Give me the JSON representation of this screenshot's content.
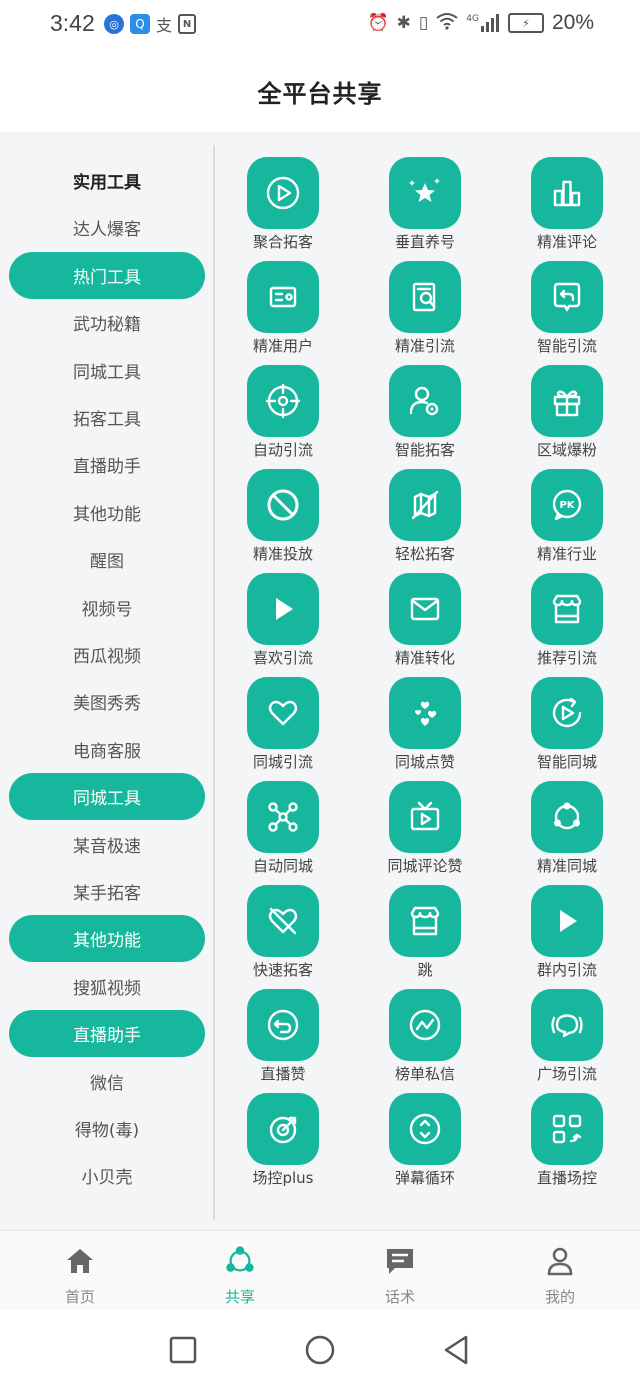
{
  "status_bar": {
    "time": "3:42",
    "left_icons": [
      "app-icon-1",
      "search-app-icon",
      "alipay-icon",
      "nfc-icon"
    ],
    "right_icons": [
      "alarm-icon",
      "bluetooth-icon",
      "vibrate-icon",
      "wifi-icon",
      "signal-icon",
      "battery-icon"
    ],
    "network": "4G",
    "battery": "20%"
  },
  "header": {
    "title": "全平台共享"
  },
  "sidebar": {
    "items": [
      {
        "label": "实用工具",
        "style": "bold"
      },
      {
        "label": "达人爆客",
        "style": "normal"
      },
      {
        "label": "热门工具",
        "style": "active"
      },
      {
        "label": "武功秘籍",
        "style": "normal"
      },
      {
        "label": "同城工具",
        "style": "normal"
      },
      {
        "label": "拓客工具",
        "style": "normal"
      },
      {
        "label": "直播助手",
        "style": "normal"
      },
      {
        "label": "其他功能",
        "style": "normal"
      },
      {
        "label": "醒图",
        "style": "normal"
      },
      {
        "label": "视频号",
        "style": "normal"
      },
      {
        "label": "西瓜视频",
        "style": "normal"
      },
      {
        "label": "美图秀秀",
        "style": "normal"
      },
      {
        "label": "电商客服",
        "style": "normal"
      },
      {
        "label": "同城工具",
        "style": "active"
      },
      {
        "label": "某音极速",
        "style": "normal"
      },
      {
        "label": "某手拓客",
        "style": "normal"
      },
      {
        "label": "其他功能",
        "style": "active"
      },
      {
        "label": "搜狐视频",
        "style": "normal"
      },
      {
        "label": "直播助手",
        "style": "active"
      },
      {
        "label": "微信",
        "style": "normal"
      },
      {
        "label": "得物(毒)",
        "style": "normal"
      },
      {
        "label": "小贝壳",
        "style": "normal"
      }
    ]
  },
  "tools": [
    {
      "label": "聚合拓客",
      "icon": "play-circle-icon"
    },
    {
      "label": "垂直养号",
      "icon": "stars-icon"
    },
    {
      "label": "精准评论",
      "icon": "bar-chart-icon"
    },
    {
      "label": "精准用户",
      "icon": "id-card-icon"
    },
    {
      "label": "精准引流",
      "icon": "document-search-icon"
    },
    {
      "label": "智能引流",
      "icon": "chat-return-icon"
    },
    {
      "label": "自动引流",
      "icon": "target-icon"
    },
    {
      "label": "智能拓客",
      "icon": "user-settings-icon"
    },
    {
      "label": "区域爆粉",
      "icon": "gift-icon"
    },
    {
      "label": "精准投放",
      "icon": "prohibited-icon"
    },
    {
      "label": "轻松拓客",
      "icon": "map-off-icon"
    },
    {
      "label": "精准行业",
      "icon": "pk-chat-icon"
    },
    {
      "label": "喜欢引流",
      "icon": "play-icon"
    },
    {
      "label": "精准转化",
      "icon": "mail-icon"
    },
    {
      "label": "推荐引流",
      "icon": "store-icon"
    },
    {
      "label": "同城引流",
      "icon": "heart-icon"
    },
    {
      "label": "同城点赞",
      "icon": "hearts-icon"
    },
    {
      "label": "智能同城",
      "icon": "replay-video-icon"
    },
    {
      "label": "自动同城",
      "icon": "network-icon"
    },
    {
      "label": "同城评论赞",
      "icon": "tv-play-icon"
    },
    {
      "label": "精准同城",
      "icon": "share-circle-icon"
    },
    {
      "label": "快速拓客",
      "icon": "heart-off-icon"
    },
    {
      "label": "跳",
      "icon": "store-icon"
    },
    {
      "label": "群内引流",
      "icon": "play-icon"
    },
    {
      "label": "直播赞",
      "icon": "undo-circle-icon"
    },
    {
      "label": "榜单私信",
      "icon": "trend-circle-icon"
    },
    {
      "label": "广场引流",
      "icon": "broadcast-chat-icon"
    },
    {
      "label": "场控plus",
      "icon": "rotate-target-icon"
    },
    {
      "label": "弹幕循环",
      "icon": "updown-circle-icon"
    },
    {
      "label": "直播场控",
      "icon": "switch-squares-icon"
    }
  ],
  "bottom_nav": [
    {
      "label": "首页",
      "icon": "home-icon",
      "active": false
    },
    {
      "label": "共享",
      "icon": "share-icon",
      "active": true
    },
    {
      "label": "话术",
      "icon": "chat-icon",
      "active": false
    },
    {
      "label": "我的",
      "icon": "user-icon",
      "active": false
    }
  ],
  "colors": {
    "accent": "#17b79d",
    "background": "#f4f5f7",
    "text": "#444444"
  }
}
